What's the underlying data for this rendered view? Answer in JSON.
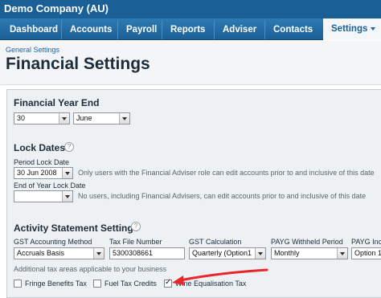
{
  "company": "Demo Company (AU)",
  "nav": {
    "items": [
      {
        "label": "Dashboard"
      },
      {
        "label": "Accounts",
        "has_dropdown": true
      },
      {
        "label": "Payroll"
      },
      {
        "label": "Reports",
        "has_dropdown": true
      },
      {
        "label": "Adviser",
        "has_dropdown": true
      },
      {
        "label": "Contacts",
        "has_dropdown": true
      },
      {
        "label": "Settings",
        "active": true,
        "has_dropdown": true
      }
    ]
  },
  "breadcrumb": "General Settings",
  "page_title": "Financial Settings",
  "financial_year_end": {
    "title": "Financial Year End",
    "day": "30",
    "month": "June"
  },
  "lock_dates": {
    "title": "Lock Dates",
    "period_label": "Period Lock Date",
    "period_value": "30 Jun 2008",
    "period_note": "Only users with the Financial Adviser role can edit accounts prior to and inclusive of this date",
    "year_label": "End of Year Lock Date",
    "year_value": "",
    "year_note": "No users, including Financial Advisers, can edit accounts prior to and inclusive of this date"
  },
  "activity": {
    "title": "Activity Statement Settings",
    "gst_method_label": "GST Accounting Method",
    "gst_method_value": "Accruals Basis",
    "tfn_label": "Tax File Number",
    "tfn_value": "5300308661",
    "gst_calc_label": "GST Calculation",
    "gst_calc_value": "Quarterly (Option1",
    "payg_withheld_label": "PAYG Withheld Period",
    "payg_withheld_value": "Monthly",
    "payg_income_label": "PAYG Inco",
    "payg_income_value": "Option 1",
    "additional_note": "Additional tax areas applicable to your business",
    "checkboxes": [
      {
        "label": "Fringe Benefits Tax",
        "checked": false
      },
      {
        "label": "Fuel Tax Credits",
        "checked": false
      },
      {
        "label": "Wine Equalisation Tax",
        "checked": true
      }
    ]
  },
  "colors": {
    "nav_bg": "#1a5f95",
    "annotation_arrow": "#e8262b"
  }
}
